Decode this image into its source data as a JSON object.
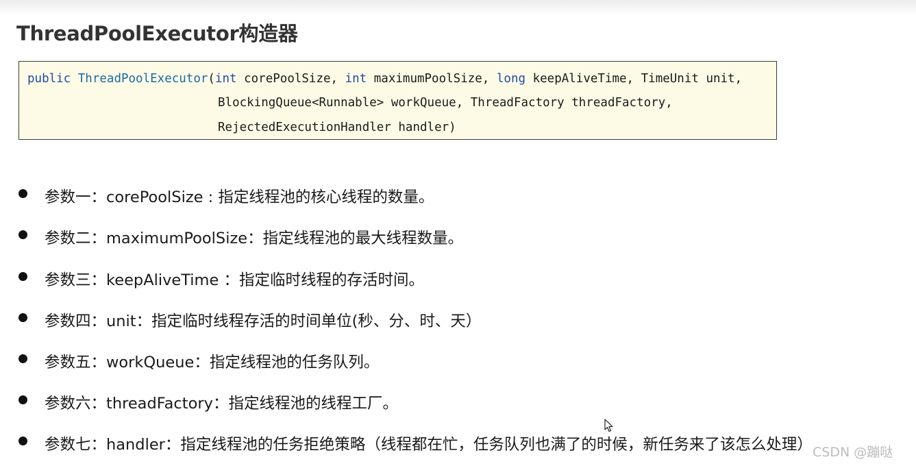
{
  "title": "ThreadPoolExecutor构造器",
  "code": {
    "line1": {
      "public": "public",
      "class_name": "ThreadPoolExecutor",
      "open": "(",
      "int1": "int",
      "p1": " corePoolSize, ",
      "int2": "int",
      "p2": " maximumPoolSize, ",
      "long": "long",
      "p3": " keepAliveTime, TimeUnit unit,"
    },
    "line2": "BlockingQueue<Runnable> workQueue, ThreadFactory threadFactory,",
    "line3": "RejectedExecutionHandler handler)"
  },
  "params": [
    {
      "label": "参数一：corePoolSize : 指定线程池的核心线程的数量。"
    },
    {
      "label": "参数二：maximumPoolSize：指定线程池的最大线程数量。"
    },
    {
      "label": "参数三：keepAliveTime ：指定临时线程的存活时间。"
    },
    {
      "label": "参数四：unit：指定临时线程存活的时间单位(秒、分、时、天）"
    },
    {
      "label": "参数五：workQueue：指定线程池的任务队列。"
    },
    {
      "label": "参数六：threadFactory：指定线程池的线程工厂。"
    },
    {
      "label": "参数七：handler：指定线程池的任务拒绝策略（线程都在忙，任务队列也满了的时候，新任务来了该怎么处理）"
    }
  ],
  "watermark": "CSDN @蹦哒",
  "icons": {
    "bullet": "bullet-dot-icon",
    "cursor": "mouse-pointer-icon"
  }
}
